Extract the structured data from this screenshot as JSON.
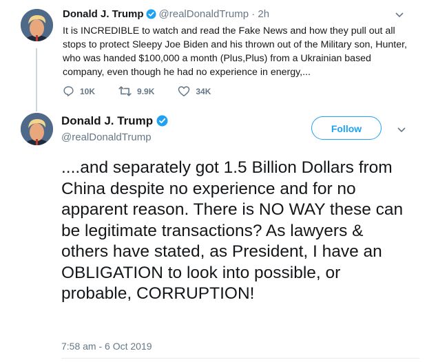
{
  "colors": {
    "accent": "#1da1f2",
    "muted": "#657786",
    "text": "#14171a"
  },
  "tweet1": {
    "author_name": "Donald J. Trump",
    "handle": "@realDonaldTrump",
    "separator": "·",
    "time_ago": "2h",
    "text": "It is INCREDIBLE to watch and read the Fake News and how they pull out all stops to protect Sleepy Joe Biden and his thrown out of the Military son, Hunter, who was handed $100,000 a month (Plus,Plus) from a Ukrainian based company, even though he had no experience in energy,...",
    "replies": "10K",
    "retweets": "9.9K",
    "likes": "34K",
    "icons": [
      "reply-icon",
      "retweet-icon",
      "like-icon",
      "verified-icon",
      "chevron-down-icon"
    ]
  },
  "tweet2": {
    "author_name": "Donald J. Trump",
    "handle": "@realDonaldTrump",
    "follow_label": "Follow",
    "text": "....and separately got 1.5 Billion Dollars from China despite no experience and for no apparent reason. There is NO WAY these can be legitimate transactions? As lawyers & others have stated, as President, I have an OBLIGATION to look into possible, or probable, CORRUPTION!",
    "timestamp": "7:58 am - 6 Oct 2019"
  }
}
